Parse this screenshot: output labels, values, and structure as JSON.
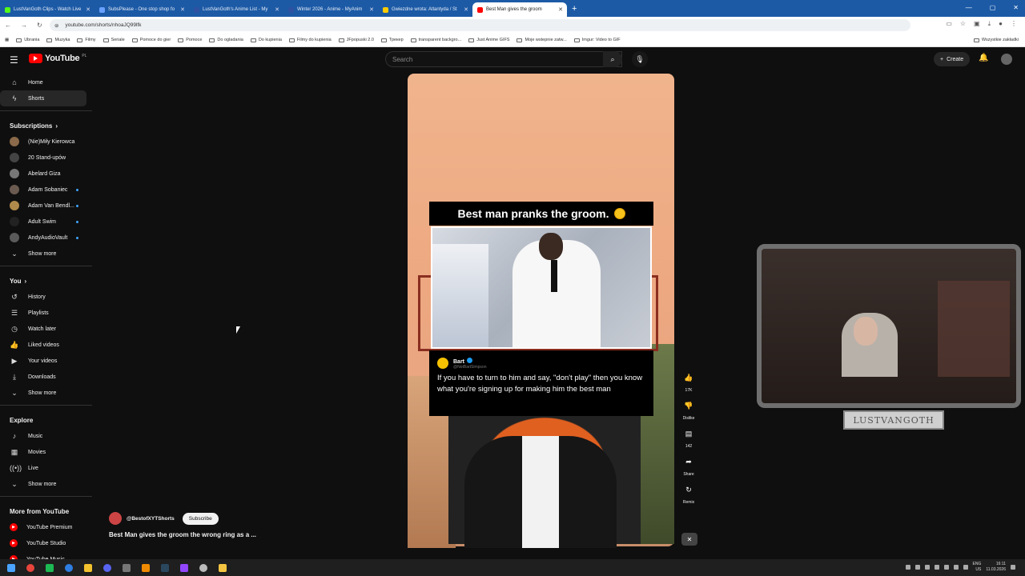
{
  "browser": {
    "tabs": [
      {
        "title": "LustVanGoth Clips - Watch Live",
        "color": "#53fc18"
      },
      {
        "title": "SubsPlease - One stop shop fo",
        "color": "#6aa0ff"
      },
      {
        "title": "LustVanGoth's Anime List - My",
        "color": "#2e51a2"
      },
      {
        "title": "Winter 2026 - Anime - MyAnim",
        "color": "#2e51a2"
      },
      {
        "title": "Gwiezdne wrota: Atlantyda / St",
        "color": "#ffcc00"
      },
      {
        "title": "Best Man gives the groom",
        "color": "#ff0000"
      }
    ],
    "url": "youtube.com/shorts/nhoaJQ99lfk",
    "bookmarks": [
      "Ubrania",
      "Muzyka",
      "Filmy",
      "Seriale",
      "Pomoce do gier",
      "Pomoce",
      "Do ogladania",
      "Do kupienia",
      "Filmy do kupienia",
      "JFpopuski 2.0",
      "Трекер",
      "transparent backgro...",
      "Just Anime GIFS",
      "Moje wstepnie zatw...",
      "Imgur: Video to GIF"
    ],
    "bookmarks_right": "Wszystkie zakładki"
  },
  "youtube": {
    "logo_text": "YouTube",
    "country": "PL",
    "search_placeholder": "Search",
    "create_label": "Create"
  },
  "sidebar": {
    "main": [
      {
        "label": "Home",
        "icon": "home-icon",
        "glyph": "⌂"
      },
      {
        "label": "Shorts",
        "icon": "shorts-icon",
        "glyph": "ϟ"
      }
    ],
    "subscriptions_heading": "Subscriptions",
    "subscriptions": [
      {
        "label": "(Nie)Miły Kierowca",
        "color": "#8a6a4a",
        "dot": false
      },
      {
        "label": "20 Stand-upów",
        "color": "#444",
        "dot": false
      },
      {
        "label": "Abelard Giza",
        "color": "#777",
        "dot": false
      },
      {
        "label": "Adam Sobaniec",
        "color": "#6b5a50",
        "dot": true
      },
      {
        "label": "Adam Van Bendl...",
        "color": "#b08a4a",
        "dot": true
      },
      {
        "label": "Adult Swim",
        "color": "#222",
        "dot": true
      },
      {
        "label": "AndyAudioVault",
        "color": "#5a5a5a",
        "dot": true
      }
    ],
    "show_more": "Show more",
    "you_heading": "You",
    "you_items": [
      {
        "label": "History",
        "icon": "history-icon",
        "glyph": "↺"
      },
      {
        "label": "Playlists",
        "icon": "playlists-icon",
        "glyph": "☰"
      },
      {
        "label": "Watch later",
        "icon": "watch-later-icon",
        "glyph": "◷"
      },
      {
        "label": "Liked videos",
        "icon": "liked-videos-icon",
        "glyph": "👍"
      },
      {
        "label": "Your videos",
        "icon": "your-videos-icon",
        "glyph": "▶"
      },
      {
        "label": "Downloads",
        "icon": "downloads-icon",
        "glyph": "⤓"
      }
    ],
    "explore_heading": "Explore",
    "explore_items": [
      {
        "label": "Music",
        "icon": "music-icon",
        "glyph": "♪"
      },
      {
        "label": "Movies",
        "icon": "movies-icon",
        "glyph": "▦"
      },
      {
        "label": "Live",
        "icon": "live-icon",
        "glyph": "((•))"
      }
    ],
    "more_heading": "More from YouTube",
    "more_items": [
      {
        "label": "YouTube Premium"
      },
      {
        "label": "YouTube Studio"
      },
      {
        "label": "YouTube Music"
      }
    ]
  },
  "short": {
    "overlay_title": "Best man pranks the groom.",
    "tweet_name": "Bart",
    "tweet_handle": "@NotBartSimpson",
    "tweet_text": "If you have to turn to him and say, \"don't play\" then you know what you're signing up for making him the best man",
    "channel": "@BestofXYTShorts",
    "subscribe_label": "Subscribe",
    "video_title": "Best Man gives the groom the wrong ring as a ..."
  },
  "actions": {
    "like_count": "17K",
    "dislike_label": "Dislike",
    "comment_count": "142",
    "share_label": "Share",
    "remix_label": "Remix"
  },
  "webcam": {
    "label": "LUSTVANGOTH"
  },
  "taskbar": {
    "lang": "ENG",
    "region": "US",
    "time": "16:11",
    "date": "11.03.2026"
  }
}
